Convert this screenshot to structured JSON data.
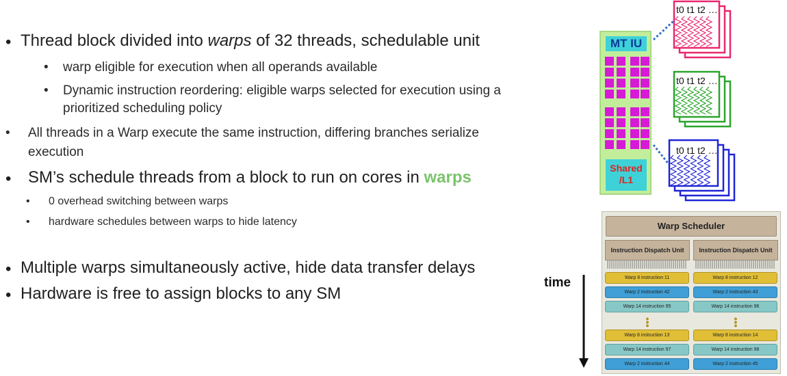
{
  "bullets": {
    "b1_pre": "Thread block divided into ",
    "b1_em": "warps",
    "b1_post": " of 32 threads, schedulable unit",
    "b1_sub1": "warp eligible for execution when all operands available",
    "b1_sub2_l1": "Dynamic instruction reordering: eligible warps selected for execution using a",
    "b1_sub2_l2": "prioritized scheduling policy",
    "b2_l1": "All threads in a Warp execute the same instruction, differing branches serialize",
    "b2_l2": "execution",
    "b3_pre": "SM’s schedule threads from a block to run on cores in ",
    "b3_green": "warps",
    "b3_sub1": "0 overhead switching between warps",
    "b3_sub2": "hardware schedules between warps to hide latency",
    "b4": "Multiple warps simultaneously active, hide data transfer delays",
    "b5": "Hardware is free to assign blocks to any SM",
    "bullet_char": "•"
  },
  "sm": {
    "mt_iu": "MT IU",
    "shared_l1": "Shared",
    "shared_l2": "/L1"
  },
  "warps": [
    {
      "label": "t0 t1 t2 …",
      "color": "#e8276f"
    },
    {
      "label": "t0 t1 t2 …",
      "color": "#2aa52a"
    },
    {
      "label": "t0 t1 t2 …",
      "color": "#1f25d6"
    }
  ],
  "scheduler": {
    "title": "Warp Scheduler",
    "dispatch_left": "Instruction Dispatch Unit",
    "dispatch_right": "Instruction Dispatch Unit",
    "left": [
      {
        "text": "Warp 8 instruction 11",
        "color": "yellow"
      },
      {
        "text": "Warp 2 instruction 42",
        "color": "blue"
      },
      {
        "text": "Warp 14 instruction 95",
        "color": "teal"
      },
      {
        "text": "Warp 8 instruction 13",
        "color": "yellow"
      },
      {
        "text": "Warp 14 instruction 97",
        "color": "teal"
      },
      {
        "text": "Warp 2 instruction 44",
        "color": "blue"
      }
    ],
    "right": [
      {
        "text": "Warp 8 instruction 12",
        "color": "yellow"
      },
      {
        "text": "Warp 2 instruction 43",
        "color": "blue"
      },
      {
        "text": "Warp 14 instruction 96",
        "color": "teal"
      },
      {
        "text": "Warp 8 instruction 14",
        "color": "yellow"
      },
      {
        "text": "Warp 14 instruction 98",
        "color": "teal"
      },
      {
        "text": "Warp 2 instruction 45",
        "color": "blue"
      }
    ]
  },
  "time_label": "time"
}
